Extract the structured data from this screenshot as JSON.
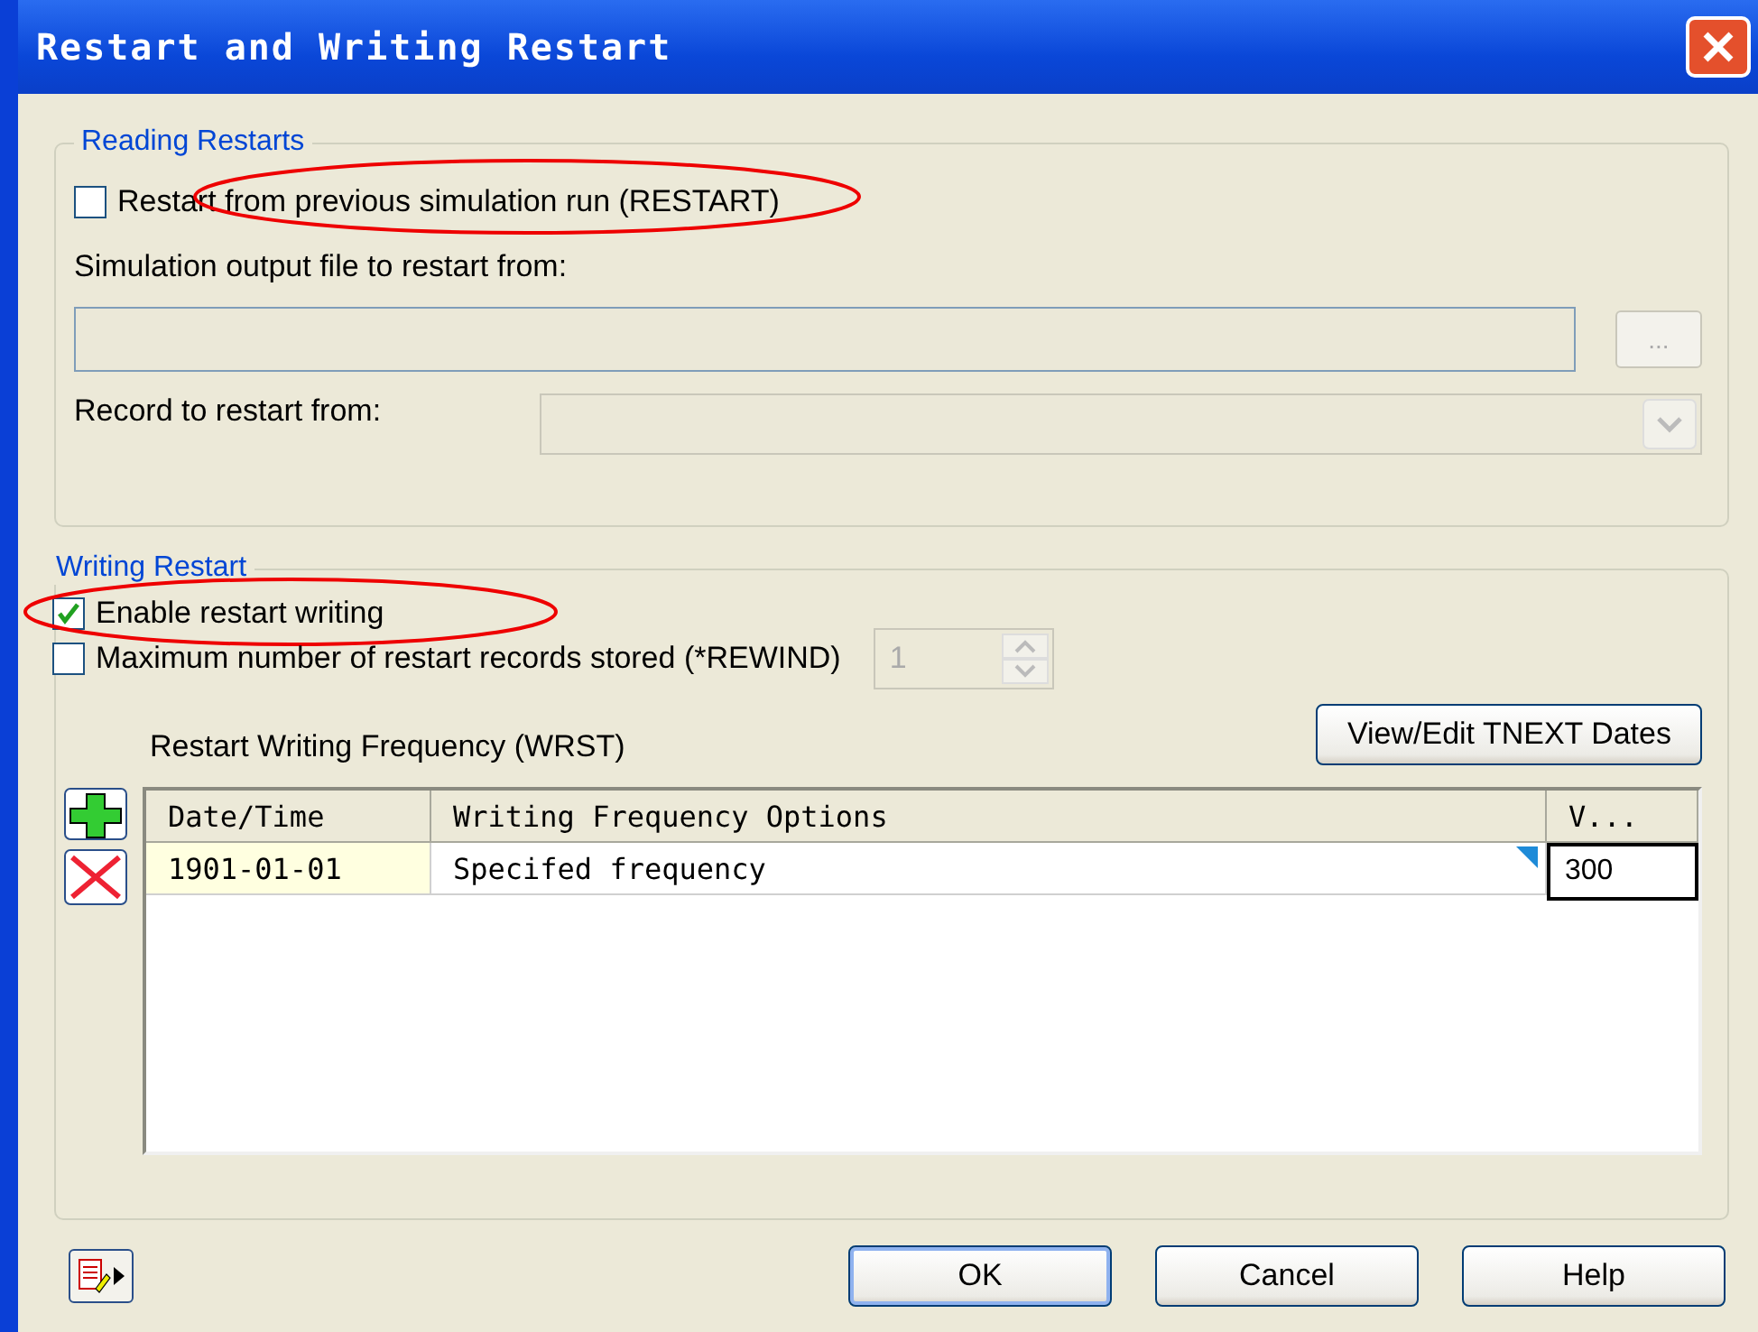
{
  "window": {
    "title": "Restart and Writing Restart"
  },
  "reading": {
    "title": "Reading Restarts",
    "restart_checkbox": {
      "label": "Restart from previous simulation run (RESTART)",
      "checked": false,
      "circled": true
    },
    "file_label": "Simulation output file to restart from:",
    "browse_button": "...",
    "record_label": "Record to restart from:"
  },
  "writing": {
    "title": "Writing Restart",
    "checkboxes": [
      {
        "label": "Enable restart writing",
        "checked": true,
        "circled": true
      },
      {
        "label": "Maximum number of restart records stored (*REWIND)",
        "checked": false,
        "circled": false
      }
    ],
    "records_value": "1",
    "frequency_label": "Restart Writing Frequency (WRST)",
    "tnext_button": "View/Edit TNEXT Dates",
    "table": {
      "columns": [
        "Date/Time",
        "Writing Frequency Options",
        "V..."
      ],
      "rows": [
        {
          "cells": [
            "1901-01-01",
            "Specifed frequency",
            "300"
          ]
        }
      ]
    }
  },
  "buttons": [
    {
      "label": "OK",
      "default": true
    },
    {
      "label": "Cancel",
      "default": false
    },
    {
      "label": "Help",
      "default": false
    }
  ]
}
